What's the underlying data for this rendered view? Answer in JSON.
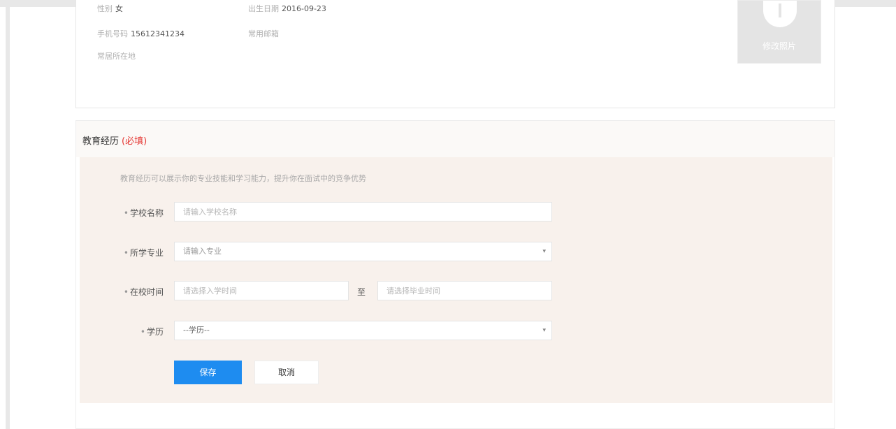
{
  "profile": {
    "gender_label": "性别",
    "gender_value": "女",
    "birth_label": "出生日期",
    "birth_value": "2016-09-23",
    "phone_label": "手机号码",
    "phone_value": "15612341234",
    "email_label": "常用邮箱",
    "location_label": "常居所在地",
    "avatar_label": "修改照片"
  },
  "education": {
    "title": "教育经历",
    "required": "(必填)",
    "tip": "教育经历可以展示你的专业技能和学习能力，提升你在面试中的竞争优势",
    "school": {
      "label": "学校名称",
      "placeholder": "请输入学校名称"
    },
    "major": {
      "label": "所学专业",
      "placeholder": "请输入专业"
    },
    "period": {
      "label": "在校时间",
      "start_placeholder": "请选择入学时间",
      "separator": "至",
      "end_placeholder": "请选择毕业时间"
    },
    "degree": {
      "label": "学历",
      "selected": "--学历--"
    },
    "save_label": "保存",
    "cancel_label": "取消"
  },
  "colors": {
    "accent": "#1e8cf0",
    "required": "#e53935",
    "section_bg": "#f8f1ec"
  }
}
